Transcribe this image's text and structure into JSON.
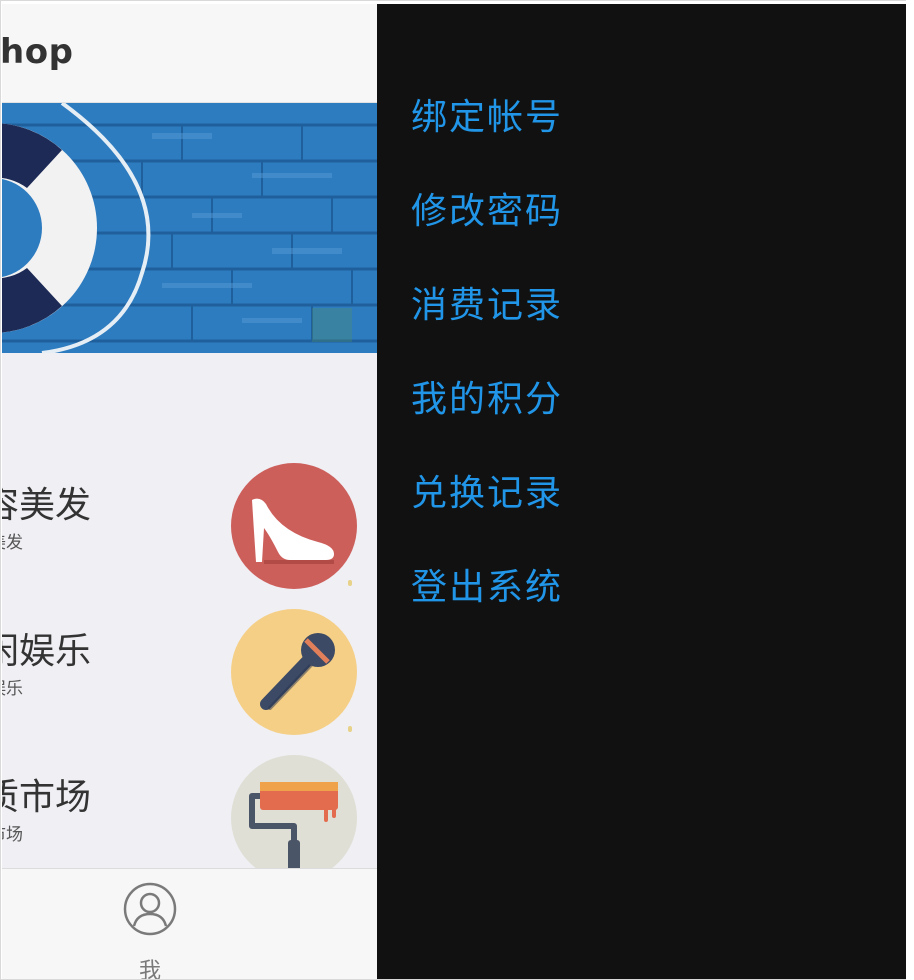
{
  "header": {
    "title": "hop"
  },
  "categories": [
    {
      "title": "容美发",
      "subtitle": "美发",
      "icon": "high-heel-shoe-icon",
      "color": "#d05f5a"
    },
    {
      "title": "闲娱乐",
      "subtitle": "娱乐",
      "icon": "microphone-icon",
      "color": "#f5cf86"
    },
    {
      "title": "质市场",
      "subtitle": "市场",
      "icon": "paint-roller-icon",
      "color": "#dfdfd6"
    }
  ],
  "tabbar": {
    "me_label": "我"
  },
  "drawer": {
    "items": [
      {
        "label": "绑定帐号"
      },
      {
        "label": "修改密码"
      },
      {
        "label": "消费记录"
      },
      {
        "label": "我的积分"
      },
      {
        "label": "兑换记录"
      },
      {
        "label": "登出系统"
      }
    ]
  },
  "colors": {
    "menu_text": "#2196e8",
    "drawer_bg": "#111111",
    "main_bg": "#efeff4",
    "banner_wood": "#2f7fc4"
  }
}
